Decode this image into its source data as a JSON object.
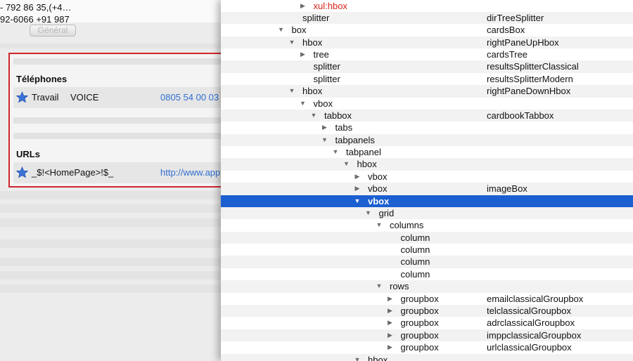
{
  "left_pane": {
    "top_lines": [
      "- 792 86 35,(+4…",
      "92-6066 +91 987"
    ],
    "tab_label": "Général",
    "phones": {
      "title": "Téléphones",
      "row": {
        "icon": "star-icon",
        "type": "Travail",
        "subtype": "VOICE",
        "value": "0805 54 00 03"
      }
    },
    "urls": {
      "title": "URLs",
      "row": {
        "icon": "star-icon",
        "label": "_$!<HomePage>!$_",
        "value": "http://www.app"
      }
    },
    "colors": {
      "star": "#3a72d8",
      "border": "#d0262d",
      "link": "#2f6fd1"
    }
  },
  "inspector": {
    "selected_color": "#1b5fd1",
    "rows": [
      {
        "tag": "xul:hbox",
        "id": "",
        "depth": 10,
        "twisty": "collapsed",
        "red": true
      },
      {
        "tag": "splitter",
        "id": "dirTreeSplitter",
        "depth": 9,
        "twisty": ""
      },
      {
        "tag": "box",
        "id": "cardsBox",
        "depth": 8,
        "twisty": "expanded"
      },
      {
        "tag": "hbox",
        "id": "rightPaneUpHbox",
        "depth": 9,
        "twisty": "expanded"
      },
      {
        "tag": "tree",
        "id": "cardsTree",
        "depth": 10,
        "twisty": "collapsed"
      },
      {
        "tag": "splitter",
        "id": "resultsSplitterClassical",
        "depth": 10,
        "twisty": ""
      },
      {
        "tag": "splitter",
        "id": "resultsSplitterModern",
        "depth": 10,
        "twisty": ""
      },
      {
        "tag": "hbox",
        "id": "rightPaneDownHbox",
        "depth": 9,
        "twisty": "expanded"
      },
      {
        "tag": "vbox",
        "id": "",
        "depth": 10,
        "twisty": "expanded"
      },
      {
        "tag": "tabbox",
        "id": "cardbookTabbox",
        "depth": 11,
        "twisty": "expanded"
      },
      {
        "tag": "tabs",
        "id": "",
        "depth": 12,
        "twisty": "collapsed"
      },
      {
        "tag": "tabpanels",
        "id": "",
        "depth": 12,
        "twisty": "expanded"
      },
      {
        "tag": "tabpanel",
        "id": "",
        "depth": 13,
        "twisty": "expanded"
      },
      {
        "tag": "hbox",
        "id": "",
        "depth": 14,
        "twisty": "expanded"
      },
      {
        "tag": "vbox",
        "id": "",
        "depth": 15,
        "twisty": "collapsed"
      },
      {
        "tag": "vbox",
        "id": "imageBox",
        "depth": 15,
        "twisty": "collapsed"
      },
      {
        "tag": "vbox",
        "id": "",
        "depth": 15,
        "twisty": "expanded",
        "selected": true
      },
      {
        "tag": "grid",
        "id": "",
        "depth": 16,
        "twisty": "expanded"
      },
      {
        "tag": "columns",
        "id": "",
        "depth": 17,
        "twisty": "expanded"
      },
      {
        "tag": "column",
        "id": "",
        "depth": 18,
        "twisty": ""
      },
      {
        "tag": "column",
        "id": "",
        "depth": 18,
        "twisty": ""
      },
      {
        "tag": "column",
        "id": "",
        "depth": 18,
        "twisty": ""
      },
      {
        "tag": "column",
        "id": "",
        "depth": 18,
        "twisty": ""
      },
      {
        "tag": "rows",
        "id": "",
        "depth": 17,
        "twisty": "expanded"
      },
      {
        "tag": "groupbox",
        "id": "emailclassicalGroupbox",
        "depth": 18,
        "twisty": "collapsed"
      },
      {
        "tag": "groupbox",
        "id": "telclassicalGroupbox",
        "depth": 18,
        "twisty": "collapsed"
      },
      {
        "tag": "groupbox",
        "id": "adrclassicalGroupbox",
        "depth": 18,
        "twisty": "collapsed"
      },
      {
        "tag": "groupbox",
        "id": "imppclassicalGroupbox",
        "depth": 18,
        "twisty": "collapsed"
      },
      {
        "tag": "groupbox",
        "id": "urlclassicalGroupbox",
        "depth": 18,
        "twisty": "collapsed"
      },
      {
        "tag": "hbox",
        "id": "",
        "depth": 15,
        "twisty": "expanded"
      }
    ]
  }
}
